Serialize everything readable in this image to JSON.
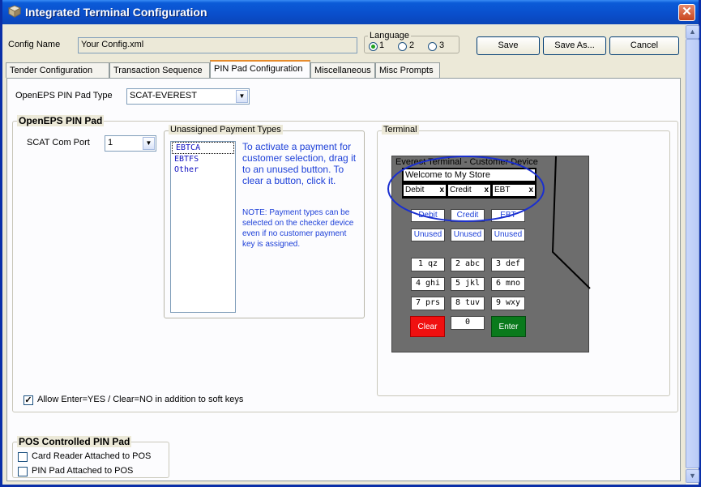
{
  "window": {
    "title": "Integrated Terminal Configuration",
    "close_glyph": "✕"
  },
  "config": {
    "name_label": "Config Name",
    "name_value": "Your Config.xml"
  },
  "language": {
    "label": "Language",
    "options": [
      "1",
      "2",
      "3"
    ],
    "selected": "1"
  },
  "buttons": {
    "save": "Save",
    "save_as": "Save As...",
    "cancel": "Cancel"
  },
  "tabs": [
    "Tender Configuration",
    "Transaction Sequence",
    "PIN Pad Configuration",
    "Miscellaneous",
    "Misc Prompts"
  ],
  "active_tab": "PIN Pad Configuration",
  "pinpad_type": {
    "label": "OpenEPS PIN Pad Type",
    "value": "SCAT-EVEREST"
  },
  "openeps": {
    "title": "OpenEPS PIN Pad",
    "com_port_label": "SCAT Com Port",
    "com_port_value": "1",
    "unassigned": {
      "title": "Unassigned Payment Types",
      "items": [
        "EBTCA",
        "EBTFS",
        "Other"
      ]
    },
    "instructions": "To activate a payment for customer selection, drag it to an unused button.  To clear a button, click it.",
    "note": "NOTE: Payment types can be selected on the checker device even if no customer payment key is assigned.",
    "allow_enter_label": "Allow Enter=YES / Clear=NO in addition to soft keys",
    "allow_enter_checked": true
  },
  "terminal": {
    "title": "Terminal",
    "device_title": "Everest Terminal - Customer Device",
    "welcome": "Welcome to My Store",
    "slots": [
      "Debit",
      "Credit",
      "EBT"
    ],
    "slot_close": "x",
    "soft_keys": [
      "Debit",
      "Credit",
      "EBT",
      "Unused",
      "Unused",
      "Unused"
    ],
    "keypad": [
      "1 qz",
      "2 abc",
      "3 def",
      "4 ghi",
      "5 jkl",
      "6 mno",
      "7 prs",
      "8 tuv",
      "9 wxy"
    ],
    "clear": "Clear",
    "zero": "0",
    "enter": "Enter",
    "colors": {
      "clear": "#f01010",
      "enter": "#0a7a1c",
      "body": "#6d6d6d",
      "highlight": "#1a2fd0"
    }
  },
  "pos_controlled": {
    "title": "POS Controlled PIN Pad",
    "card_reader_label": "Card Reader Attached to POS",
    "card_reader_checked": false,
    "pinpad_label": "PIN Pad Attached to POS",
    "pinpad_checked": false
  },
  "scrollbar": {
    "up": "▲",
    "down": "▼"
  }
}
